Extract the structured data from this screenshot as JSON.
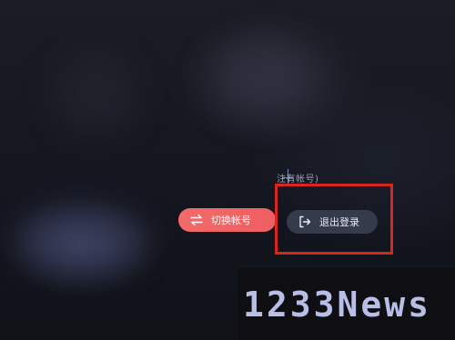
{
  "account": {
    "hint_text": "注有帐号)"
  },
  "buttons": {
    "switch_account": {
      "label": "切换帐号",
      "icon": "swap-arrows-icon",
      "color": "#ee5f62"
    },
    "logout": {
      "label": "退出登录",
      "icon": "logout-icon",
      "color": "#353a4d"
    }
  },
  "annotation": {
    "highlight_color": "#d8261f"
  },
  "watermark": {
    "text": "1233News"
  }
}
